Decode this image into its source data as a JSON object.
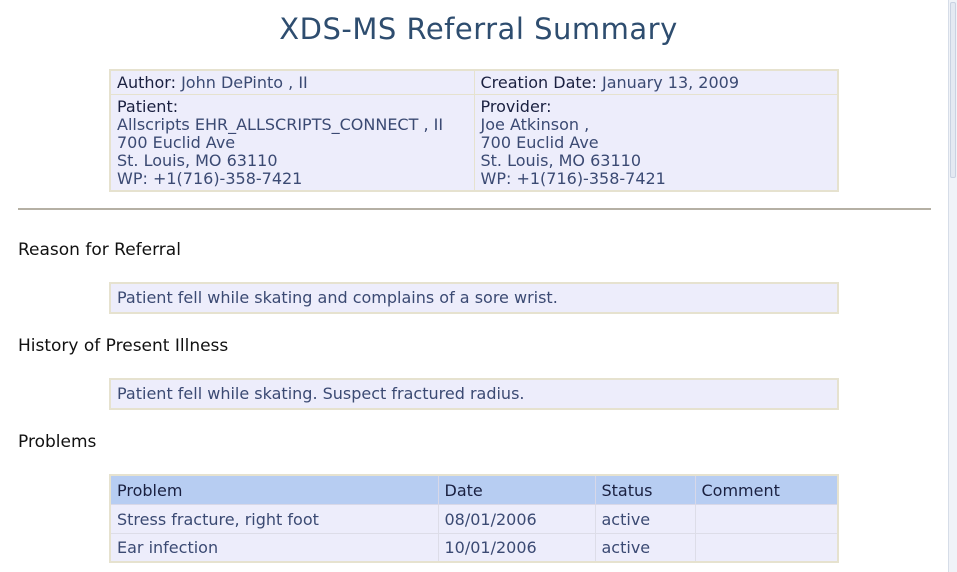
{
  "document": {
    "title": "XDS-MS Referral Summary"
  },
  "header": {
    "author_label": "Author:",
    "author_value": "John DePinto , II",
    "creation_label": "Creation Date:",
    "creation_value": "January 13, 2009",
    "patient_label": "Patient:",
    "patient_lines": [
      "Allscripts EHR_ALLSCRIPTS_CONNECT , II",
      "700 Euclid Ave",
      "St. Louis, MO 63110",
      "WP: +1(716)-358-7421"
    ],
    "provider_label": "Provider:",
    "provider_lines": [
      "Joe Atkinson ,",
      "700 Euclid Ave",
      "St. Louis, MO 63110",
      "WP: +1(716)-358-7421"
    ]
  },
  "sections": {
    "reason": {
      "title": "Reason for Referral",
      "text": "Patient fell while skating and complains of a sore wrist."
    },
    "history": {
      "title": "History of Present Illness",
      "text": "Patient fell while skating. Suspect fractured radius."
    },
    "problems": {
      "title": "Problems",
      "columns": [
        "Problem",
        "Date",
        "Status",
        "Comment"
      ],
      "rows": [
        [
          "Stress fracture, right foot",
          "08/01/2006",
          "active",
          ""
        ],
        [
          "Ear infection",
          "10/01/2006",
          "active",
          ""
        ]
      ]
    }
  },
  "colors": {
    "title": "#2e4d6f",
    "box_bg": "#ededfb",
    "box_border": "#e6e2cf",
    "table_header_bg": "#b7cdf2",
    "text": "#3b4a73"
  }
}
